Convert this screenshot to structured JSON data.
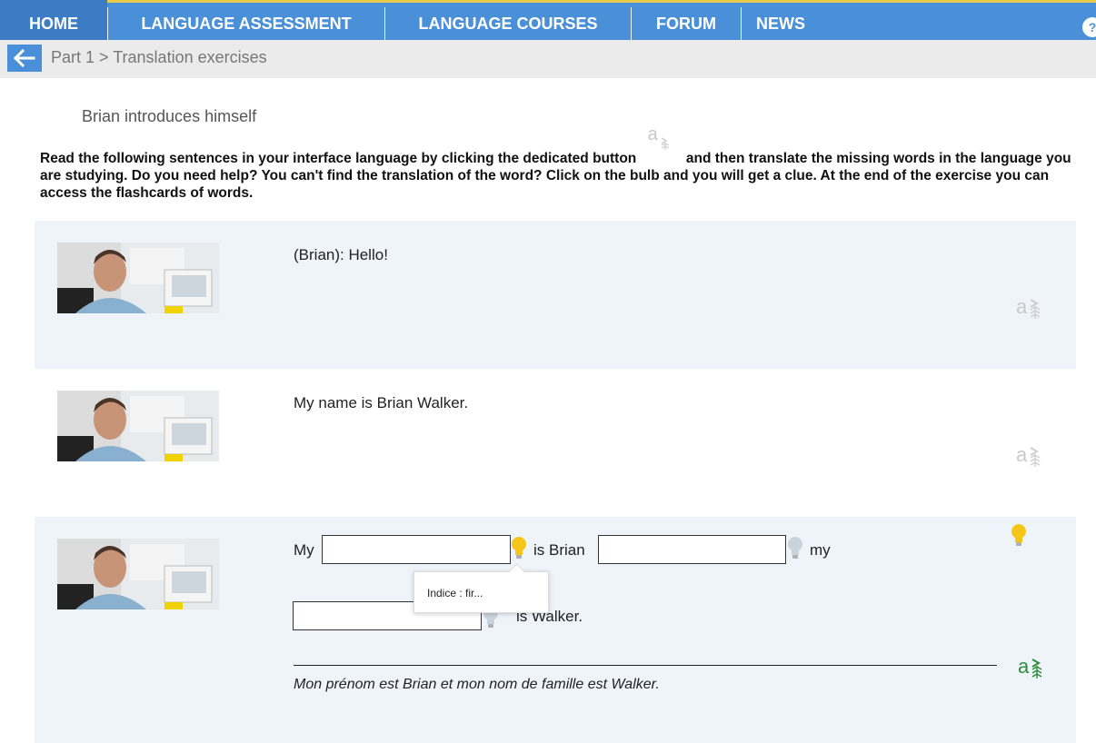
{
  "nav": {
    "items": [
      "HOME",
      "LANGUAGE ASSESSMENT",
      "LANGUAGE COURSES",
      "FORUM",
      "NEWS"
    ],
    "help_label": "?"
  },
  "breadcrumb": {
    "text": "Part 1 > Translation exercises"
  },
  "lesson": {
    "subtitle": "Brian introduces himself"
  },
  "instructions": {
    "before": "Read the following sentences in your interface language by clicking the dedicated button",
    "after": "and then translate the missing words in the language you are studying. Do you need help? You can't find the translation of the word? Click on the bulb and you will get a clue. At the end of the exercise you can access the flashcards of words."
  },
  "icons": {
    "translate": "a",
    "bulb": "lightbulb-icon",
    "back": "arrow-left-icon"
  },
  "rows": [
    {
      "sentence": "(Brian): Hello!"
    },
    {
      "sentence": "My name is Brian Walker."
    },
    {
      "part1": "My",
      "part2": "is Brian",
      "part3": "my",
      "part4": "is Walker.",
      "inputs": [
        "",
        "",
        ""
      ],
      "tooltip": "Indice : fir...",
      "translation": "Mon prénom est Brian et mon nom de famille est Walker."
    }
  ],
  "colors": {
    "nav": "#4a90d9",
    "row_shade": "#eef4fa",
    "translate_active": "#2e8b3a",
    "bulb_active": "#f5c518"
  }
}
